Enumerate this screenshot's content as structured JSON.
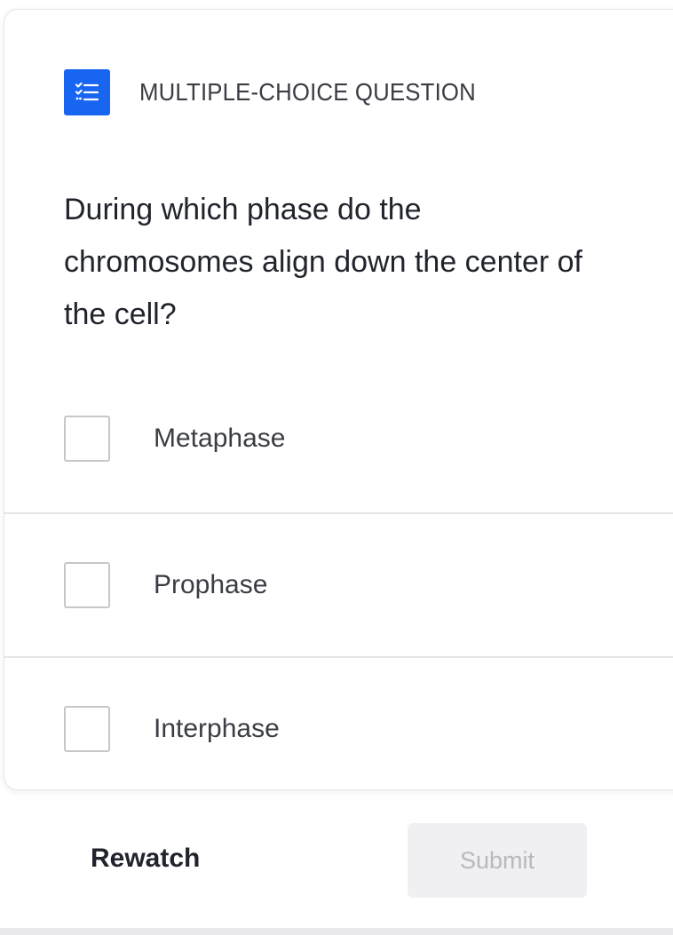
{
  "header": {
    "icon": "checklist-icon",
    "accent_color": "#1865f2",
    "label": "MULTIPLE-CHOICE QUESTION"
  },
  "question": {
    "text": "During which phase do the chromosomes align down the center of the cell?"
  },
  "options": [
    {
      "label": "Metaphase",
      "checked": false
    },
    {
      "label": "Prophase",
      "checked": false
    },
    {
      "label": "Interphase",
      "checked": false
    }
  ],
  "footer": {
    "rewatch_label": "Rewatch",
    "submit_label": "Submit",
    "submit_enabled": false
  }
}
